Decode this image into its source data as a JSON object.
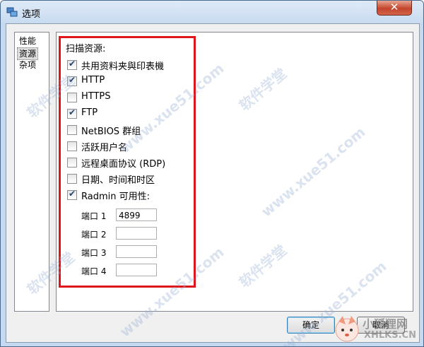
{
  "window": {
    "title": "选项",
    "close": "✕"
  },
  "nav": {
    "items": [
      {
        "label": "性能",
        "selected": false
      },
      {
        "label": "资源",
        "selected": true
      },
      {
        "label": "杂项",
        "selected": false
      }
    ]
  },
  "panel": {
    "section_title": "扫描资源:",
    "checkboxes": [
      {
        "label": "共用资料夹與印表機",
        "checked": true
      },
      {
        "label": "HTTP",
        "checked": true
      },
      {
        "label": "HTTPS",
        "checked": false
      },
      {
        "label": "FTP",
        "checked": true
      },
      {
        "label": "NetBIOS 群组",
        "checked": false
      },
      {
        "label": "活跃用户名",
        "checked": false
      },
      {
        "label": "远程桌面协议 (RDP)",
        "checked": false
      },
      {
        "label": "日期、时间和时区",
        "checked": false
      },
      {
        "label": "Radmin 可用性:",
        "checked": true
      }
    ],
    "ports": [
      {
        "label": "端口 1",
        "value": "4899"
      },
      {
        "label": "端口 2",
        "value": ""
      },
      {
        "label": "端口 3",
        "value": ""
      },
      {
        "label": "端口 4",
        "value": ""
      }
    ]
  },
  "buttons": {
    "ok": "确定",
    "cancel": "取消"
  },
  "watermark": {
    "text": "软件学堂",
    "url": "www.xue51.com",
    "badge_name": "小狐狸网",
    "badge_url": "XHLKS.CN"
  },
  "colors": {
    "highlight_border": "#e0141b",
    "check": "#21436f"
  }
}
